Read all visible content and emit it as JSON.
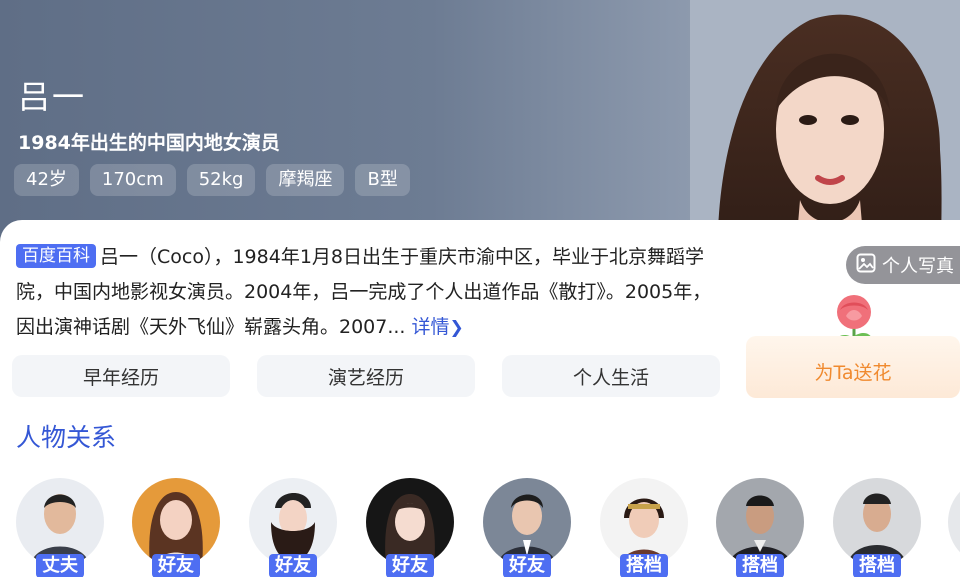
{
  "person": {
    "name": "吕一",
    "subtitle": "1984年出生的中国内地女演员",
    "tags": [
      "42岁",
      "170cm",
      "52kg",
      "摩羯座",
      "B型"
    ]
  },
  "bio": {
    "badge": "百度百科",
    "text": "吕一（Coco），1984年1月8日出生于重庆市渝中区，毕业于北京舞蹈学院，中国内地影视女演员。2004年，吕一完成了个人出道作品《散打》。2005年，因出演神话剧《天外飞仙》崭露头角。2007...",
    "more_label": "详情",
    "more_icon": "chevron-right-icon"
  },
  "photo_button": {
    "label": "个人写真",
    "icon": "image-icon"
  },
  "flower_button": {
    "label": "为Ta送花",
    "icon": "rose-icon"
  },
  "tabs": [
    {
      "label": "早年经历"
    },
    {
      "label": "演艺经历"
    },
    {
      "label": "个人生活"
    }
  ],
  "relations": {
    "title": "人物关系",
    "items": [
      {
        "label": "丈夫"
      },
      {
        "label": "好友"
      },
      {
        "label": "好友"
      },
      {
        "label": "好友"
      },
      {
        "label": "好友"
      },
      {
        "label": "搭档"
      },
      {
        "label": "搭档"
      },
      {
        "label": "搭档"
      }
    ]
  },
  "colors": {
    "accent": "#4e6ef2",
    "link": "#3457d5",
    "flower_text": "#f08a2f",
    "tab_bg": "#f3f5f8",
    "header_bg": "#6d7c93"
  }
}
